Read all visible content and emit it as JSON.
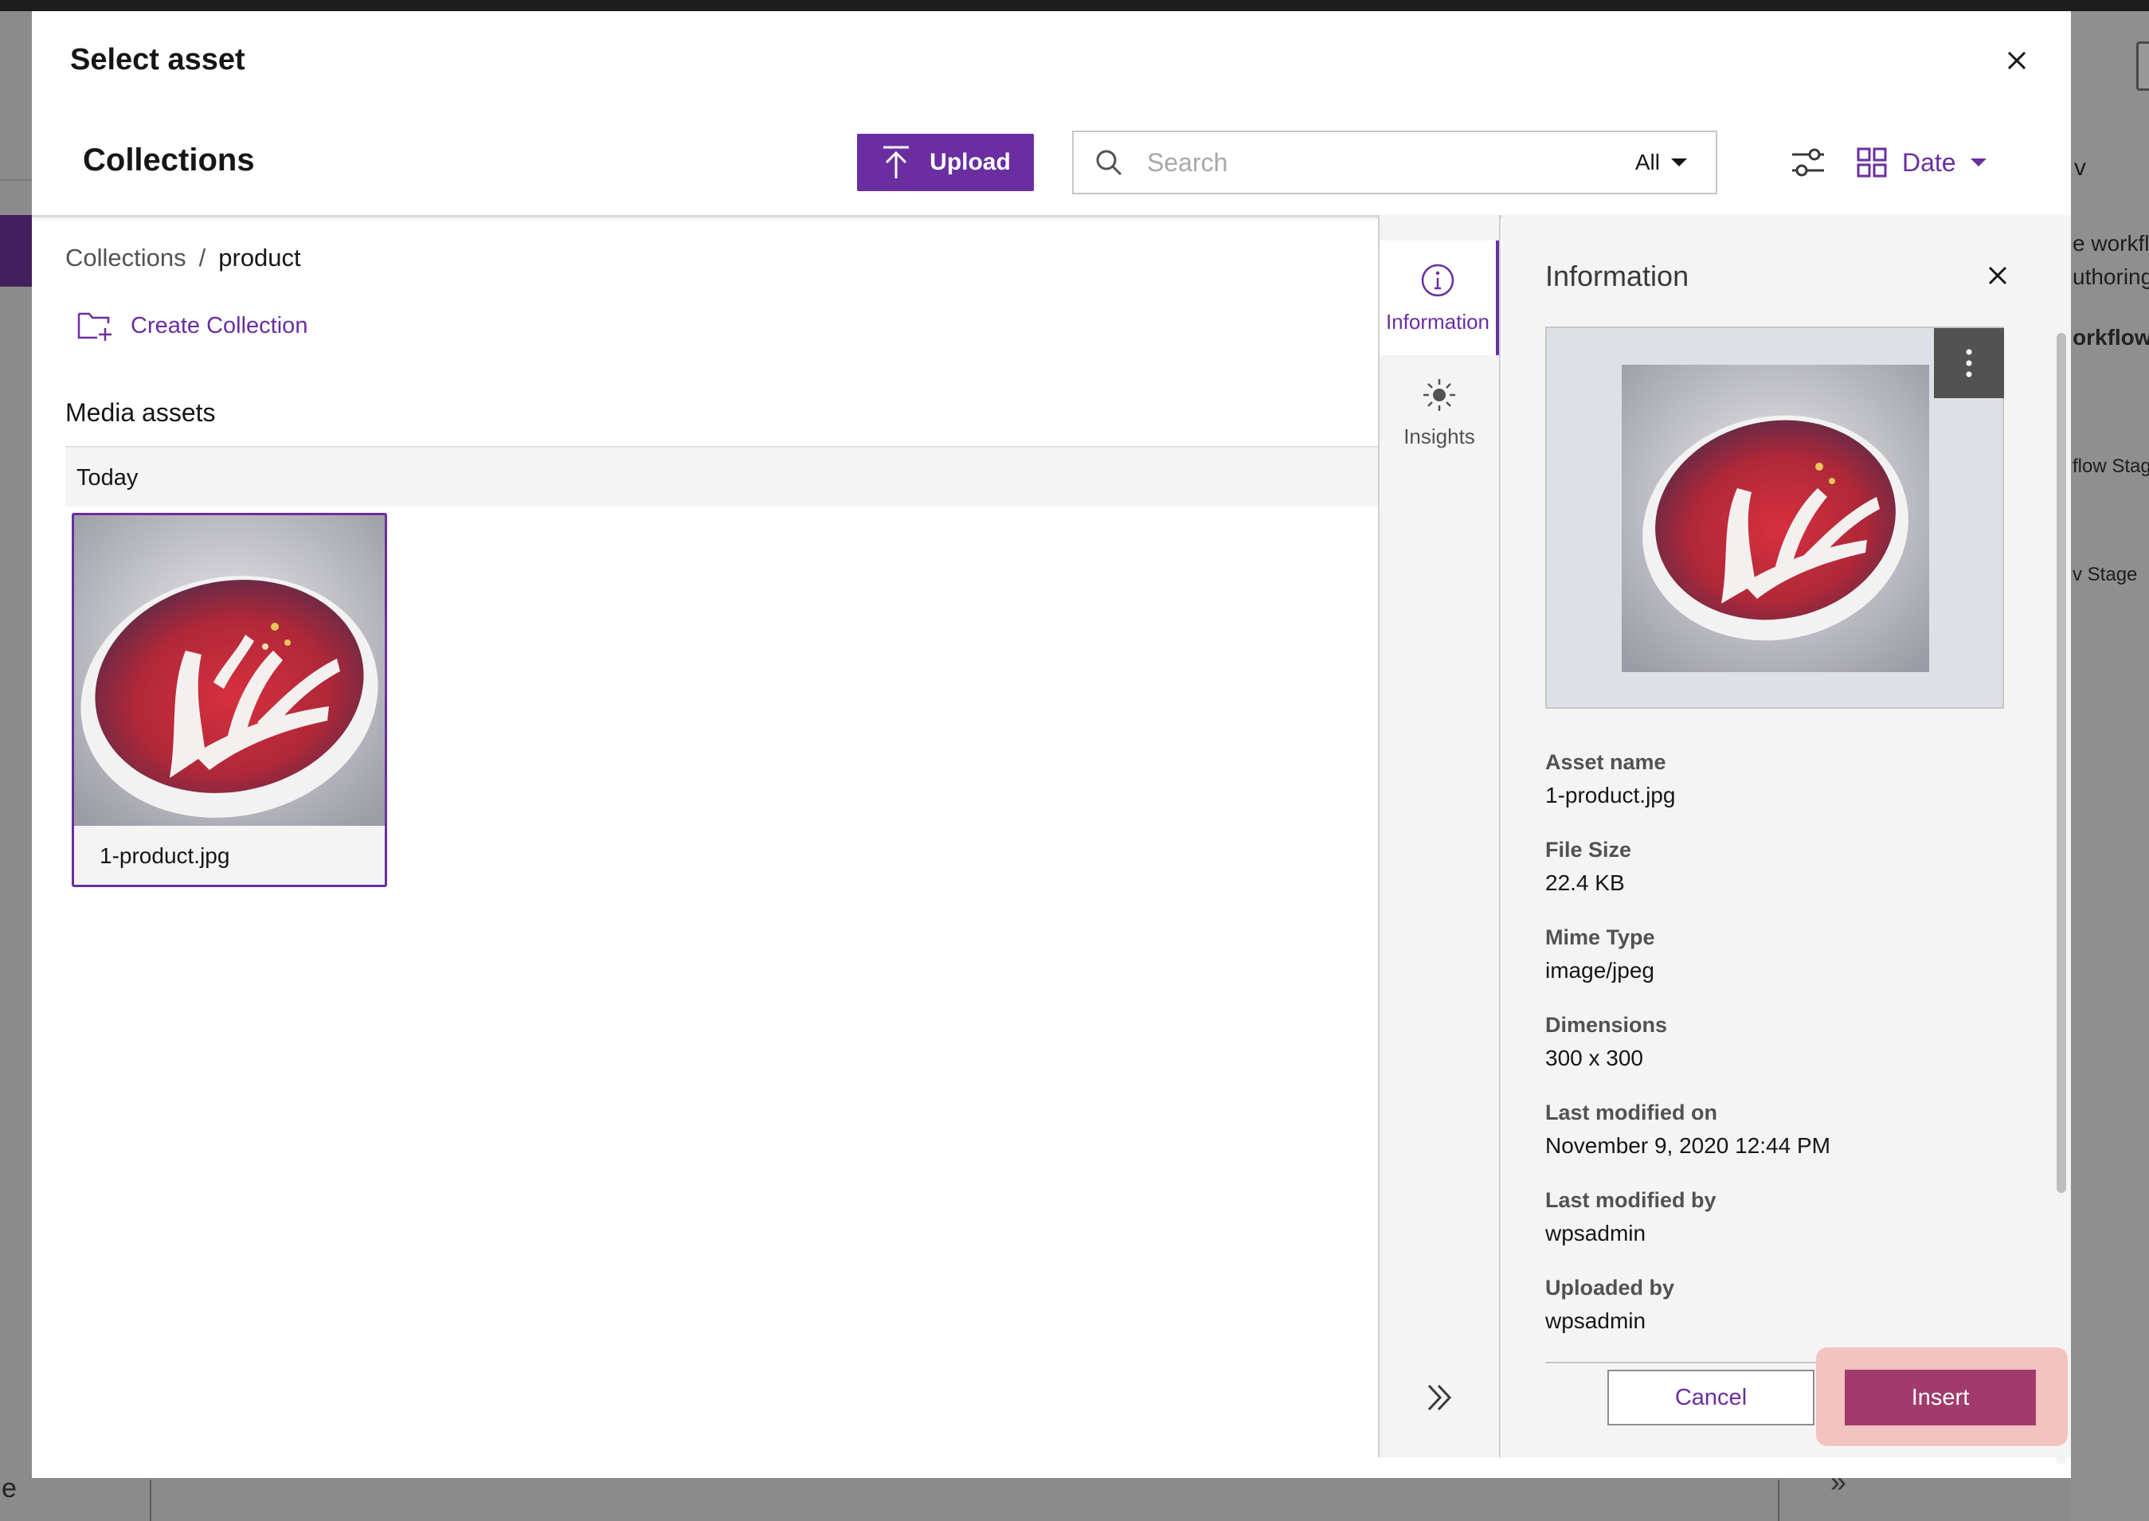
{
  "background": {
    "right_texts": [
      "e workfl",
      "uthoring",
      "orkflow",
      "flow Stag",
      "v Stage"
    ],
    "left_char": "e",
    "bottom_chevron": "»"
  },
  "modal": {
    "title": "Select asset",
    "toolbar": {
      "title": "Collections",
      "upload_label": "Upload",
      "search_placeholder": "Search",
      "search_scope": "All",
      "sort_label": "Date"
    },
    "breadcrumb": {
      "parent": "Collections",
      "separator": "/",
      "current": "product"
    },
    "create_collection_label": "Create Collection",
    "section_title": "Media assets",
    "groups": [
      {
        "label": "Today",
        "assets": [
          {
            "name": "1-product.jpg",
            "selected": true
          }
        ]
      }
    ],
    "rail": {
      "tabs": [
        {
          "label": "Information",
          "icon": "information-icon",
          "active": true
        },
        {
          "label": "Insights",
          "icon": "insights-icon",
          "active": false
        }
      ]
    },
    "info_panel": {
      "title": "Information",
      "fields": [
        {
          "label": "Asset name",
          "value": "1-product.jpg"
        },
        {
          "label": "File Size",
          "value": "22.4 KB"
        },
        {
          "label": "Mime Type",
          "value": "image/jpeg"
        },
        {
          "label": "Dimensions",
          "value": "300 x 300"
        },
        {
          "label": "Last modified on",
          "value": "November 9, 2020 12:44 PM"
        },
        {
          "label": "Last modified by",
          "value": "wpsadmin"
        },
        {
          "label": "Uploaded by",
          "value": "wpsadmin"
        }
      ]
    },
    "actions": {
      "cancel_label": "Cancel",
      "insert_label": "Insert"
    }
  },
  "colors": {
    "accent": "#6a2ea1",
    "insert": "#a13b6e",
    "insert_highlight": "#f3c3c0"
  }
}
